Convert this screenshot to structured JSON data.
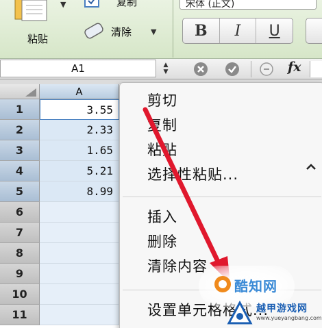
{
  "ribbon": {
    "paste_label": "粘贴",
    "copy_label": "复制",
    "clear_label": "清除",
    "font_name": "宋体 (正文)",
    "format_buttons": {
      "bold": "B",
      "italic": "I",
      "underline": "U"
    }
  },
  "formula_bar": {
    "name_box": "A1",
    "fx_label": "fx"
  },
  "grid": {
    "column_header": "A",
    "rows": [
      {
        "number": "1",
        "value": "3.55"
      },
      {
        "number": "2",
        "value": "2.33"
      },
      {
        "number": "3",
        "value": "1.65"
      },
      {
        "number": "4",
        "value": "5.21"
      },
      {
        "number": "5",
        "value": "8.99"
      },
      {
        "number": "6",
        "value": ""
      },
      {
        "number": "7",
        "value": ""
      },
      {
        "number": "8",
        "value": ""
      },
      {
        "number": "9",
        "value": ""
      },
      {
        "number": "10",
        "value": ""
      },
      {
        "number": "11",
        "value": ""
      }
    ]
  },
  "context_menu": {
    "items": [
      {
        "label": "剪切"
      },
      {
        "label": "复制"
      },
      {
        "label": "粘贴"
      },
      {
        "label": "选择性粘贴..."
      },
      {
        "label": "插入"
      },
      {
        "label": "删除"
      },
      {
        "label": "清除内容"
      },
      {
        "label": "设置单元格格式..."
      }
    ]
  },
  "overlay": {
    "arrow_color": "#e0182d",
    "watermark_text": "酷知网",
    "brand_name": "越甲游戏网",
    "brand_url": "www.yueyangbang.com"
  },
  "colors": {
    "ribbon": "#dbe9cf",
    "selection": "#e6eff9",
    "brand_blue": "#1b5fb3"
  }
}
